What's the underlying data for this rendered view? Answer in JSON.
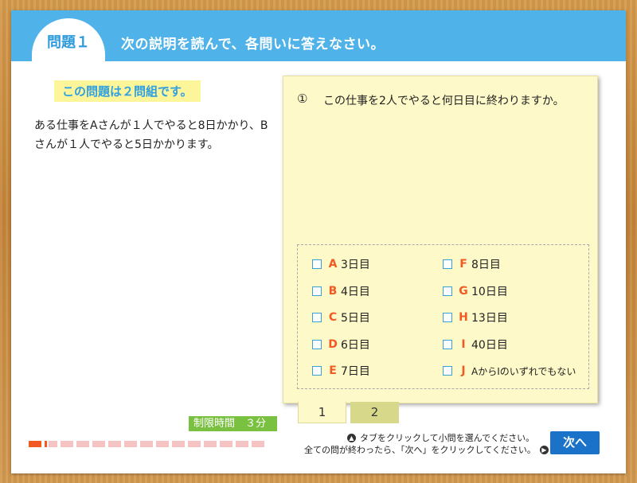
{
  "header": {
    "question_tab": "問題１",
    "title": "次の説明を読んで、各問いに答えなさい。",
    "accent_color": "#4fb3e9"
  },
  "problem": {
    "pair_badge": "この問題は２問組です。",
    "text": "ある仕事をAさんが１人でやると8日かかり、Bさんが１人でやると5日かかります。"
  },
  "question": {
    "number": "①",
    "text": "この仕事を2人でやると何日目に終わりますか。"
  },
  "choices": [
    {
      "letter": "A",
      "text": "3日目"
    },
    {
      "letter": "B",
      "text": "4日目"
    },
    {
      "letter": "C",
      "text": "5日目"
    },
    {
      "letter": "D",
      "text": "6日目"
    },
    {
      "letter": "E",
      "text": "7日目"
    },
    {
      "letter": "F",
      "text": "8日目"
    },
    {
      "letter": "G",
      "text": "10日目"
    },
    {
      "letter": "H",
      "text": "13日目"
    },
    {
      "letter": "I",
      "text": "40日目"
    },
    {
      "letter": "J",
      "text": "AからIのいずれでもない"
    }
  ],
  "subtabs": [
    "1",
    "2"
  ],
  "footer": {
    "time_limit": "制限時間　３分",
    "hint1": "タブをクリックして小問を選んでください。",
    "hint2": "全ての問が終わったら、「次へ」をクリックしてください。",
    "next_button": "次へ"
  },
  "progress": {
    "total_segments": 14,
    "completed_fraction": 0.1
  }
}
